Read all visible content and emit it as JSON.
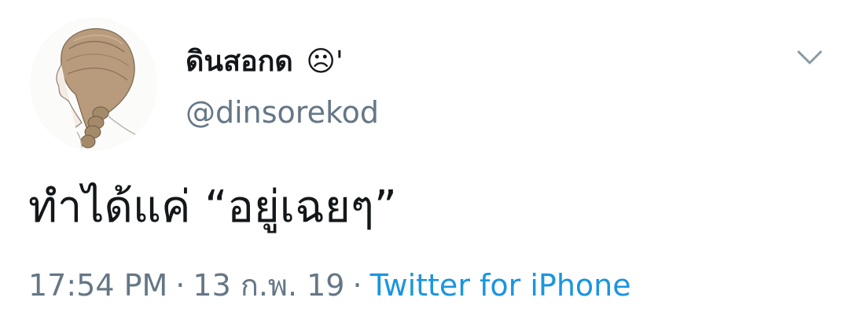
{
  "author": {
    "display_name": "ดินสอกด",
    "name_suffix": "☹'",
    "handle": "@dinsorekod"
  },
  "tweet": {
    "text": "ทำได้แค่ “อยู่เฉยๆ”"
  },
  "meta": {
    "time": "17:54 PM",
    "date": "13 ก.พ. 19",
    "separator": "·",
    "source": "Twitter for iPhone"
  },
  "icons": {
    "menu": "chevron-down-icon",
    "avatar": "avatar-illustration"
  },
  "colors": {
    "text_primary": "#14171a",
    "text_secondary": "#657786",
    "link": "#1b95e0"
  }
}
